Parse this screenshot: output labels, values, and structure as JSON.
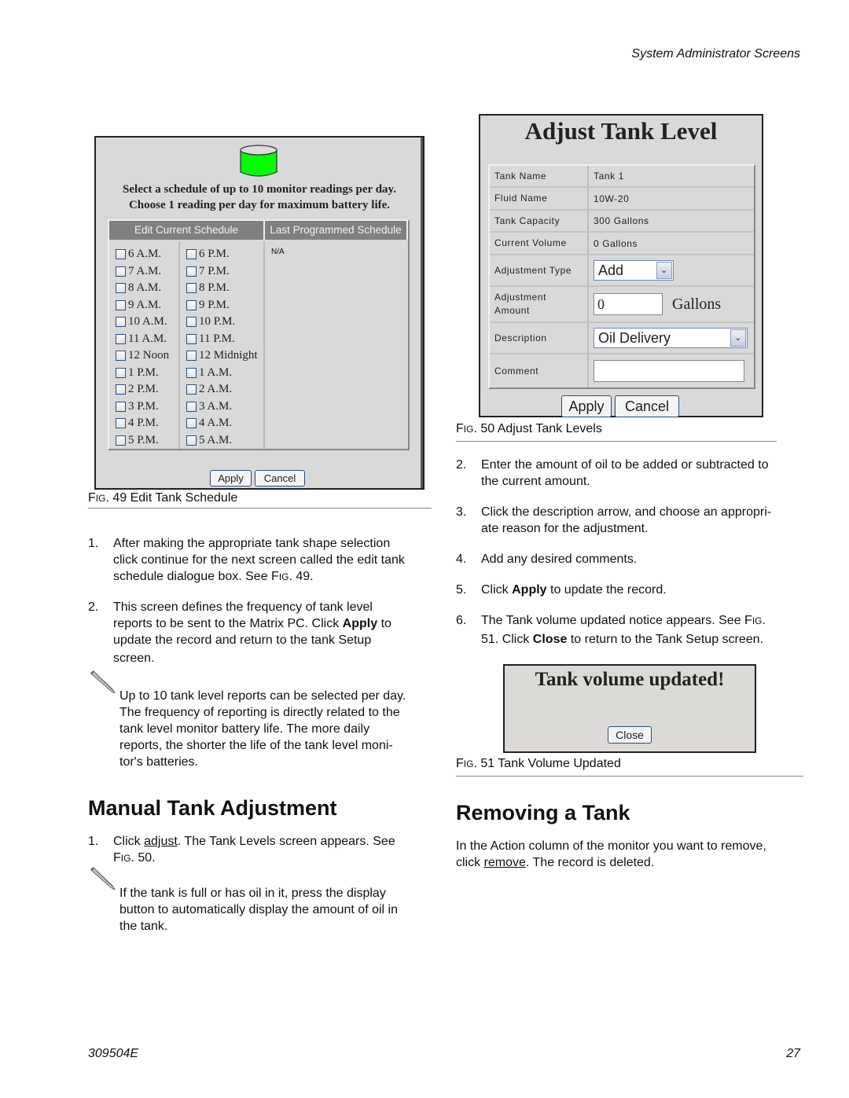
{
  "header": {
    "section_title": "System Administrator Screens"
  },
  "footer": {
    "doc_number": "309504E",
    "page_number": "27"
  },
  "fig49": {
    "instruction_line1": "Select a schedule of up to 10 monitor readings per day.",
    "instruction_line2": "Choose 1 reading per day for maximum battery life.",
    "col_edit_header": "Edit Current Schedule",
    "col_last_header": "Last Programmed Schedule",
    "last_programmed_value": "N/A",
    "column1": [
      "6 A.M.",
      "7 A.M.",
      "8 A.M.",
      "9 A.M.",
      "10 A.M.",
      "11 A.M.",
      "12 Noon",
      "1 P.M.",
      "2 P.M.",
      "3 P.M.",
      "4 P.M.",
      "5 P.M."
    ],
    "column2": [
      "6 P.M.",
      "7 P.M.",
      "8 P.M.",
      "9 P.M.",
      "10 P.M.",
      "11 P.M.",
      "12 Midnight",
      "1 A.M.",
      "2 A.M.",
      "3 A.M.",
      "4 A.M.",
      "5 A.M."
    ],
    "tank_color": "#00ff00",
    "apply_label": "Apply",
    "cancel_label": "Cancel",
    "caption_prefix": "F",
    "caption_small": "IG",
    "caption_rest": ". 49 Edit Tank Schedule"
  },
  "left_steps": [
    {
      "num": "1.",
      "text_parts": [
        "After making the appropriate tank shape selection",
        "click continue for the next screen called the edit tank",
        "schedule dialogue box. See F",
        "IG",
        ". 49."
      ]
    },
    {
      "num": "2.",
      "line1": "This screen defines the frequency of tank level",
      "line2a": "reports to be sent to the Matrix PC. Click ",
      "line2b": "Apply",
      "line2c": " to",
      "line3": "update the record and return to the tank Setup",
      "line4": "screen."
    }
  ],
  "note1": [
    "Up to 10 tank level reports can be selected per day.",
    "The frequency of reporting is directly related to the",
    "tank level monitor battery life. The more daily",
    "reports, the shorter the life of the tank level moni-",
    "tor's batteries."
  ],
  "manual_section": {
    "heading": "Manual Tank Adjustment",
    "step_num": "1.",
    "step_a": "Click ",
    "step_link": "adjust",
    "step_b": ". The Tank Levels screen appears. See",
    "step_c1": "F",
    "step_c2": "IG",
    "step_c3": ". 50.",
    "note": [
      "If the tank is full or has oil in it, press the display",
      "button to automatically display the amount of oil in",
      "the tank."
    ]
  },
  "fig50": {
    "title": "Adjust Tank Level",
    "rows": [
      {
        "label": "Tank Name",
        "value": "Tank 1"
      },
      {
        "label": "Fluid Name",
        "value": "10W-20"
      },
      {
        "label": "Tank Capacity",
        "value": "300 Gallons"
      },
      {
        "label": "Current Volume",
        "value": "0 Gallons"
      }
    ],
    "adjustment_type_label": "Adjustment Type",
    "adjustment_type_value": "Add",
    "adjustment_amount_label1": "Adjustment",
    "adjustment_amount_label2": "Amount",
    "adjustment_amount_value": "0",
    "adjustment_unit": "Gallons",
    "description_label": "Description",
    "description_value": "Oil Delivery",
    "comment_label": "Comment",
    "comment_value": "",
    "apply_label": "Apply",
    "cancel_label": "Cancel",
    "caption_prefix": "F",
    "caption_small": "IG",
    "caption_rest": ". 50 Adjust Tank Levels"
  },
  "right_steps": {
    "s2_num": "2.",
    "s2_l1": "Enter the amount of oil to be added or subtracted to",
    "s2_l2": "the current amount.",
    "s3_num": "3.",
    "s3_l1": "Click the description arrow, and choose an appropri-",
    "s3_l2": "ate reason for the adjustment.",
    "s4_num": "4.",
    "s4_l1": "Add any desired comments.",
    "s5_num": "5.",
    "s5_a": "Click ",
    "s5_b": "Apply",
    "s5_c": " to update the record.",
    "s6_num": "6.",
    "s6_a": "The Tank volume updated notice appears. See F",
    "s6_b": "IG",
    "s6_c": ".",
    "s6_d": "51. Click ",
    "s6_e": "Close",
    "s6_f": " to return to the Tank Setup screen."
  },
  "fig51": {
    "title": "Tank volume updated!",
    "close_label": "Close",
    "caption_prefix": "F",
    "caption_small": "IG",
    "caption_rest": ". 51 Tank Volume Updated"
  },
  "removing_section": {
    "heading": "Removing a Tank",
    "line1": "In the Action column of the monitor you want to remove,",
    "line2a": "click ",
    "link": "remove",
    "line2b": ". The record is deleted."
  }
}
